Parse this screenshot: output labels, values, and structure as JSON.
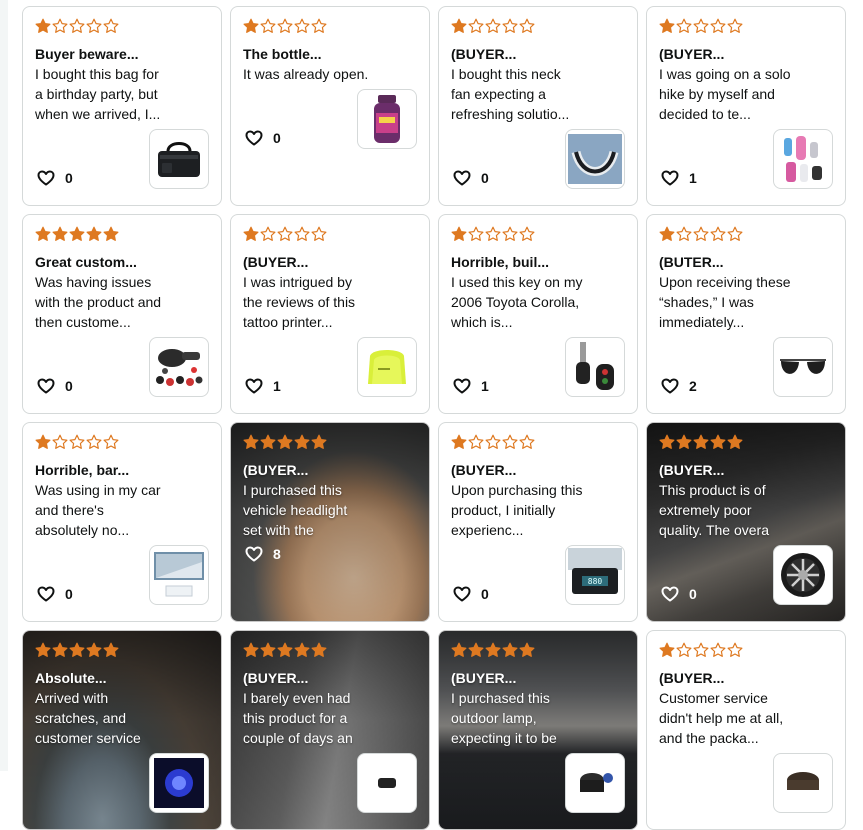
{
  "colors": {
    "star_fill": "#de7921",
    "star_empty_stroke": "#de7921",
    "card_border": "#d5d9d9",
    "text": "#0f1111"
  },
  "reviews": [
    {
      "rating": 1,
      "title": "Buyer beware...",
      "body": "I bought this bag for a birthday party, but when we arrived, I...",
      "likes": "0",
      "thumb_icon": "cooler-bag-icon"
    },
    {
      "rating": 1,
      "title": "The bottle...",
      "body": "It was already open.",
      "likes": "0",
      "thumb_icon": "supplement-bottle-icon"
    },
    {
      "rating": 1,
      "title": "(BUYER...",
      "body": "I bought this neck fan expecting a refreshing solutio...",
      "likes": "0",
      "thumb_icon": "neck-fan-icon"
    },
    {
      "rating": 1,
      "title": "(BUYER...",
      "body": "I was going on a solo hike by myself and decided to te...",
      "likes": "1",
      "thumb_icon": "water-bottles-icon"
    },
    {
      "rating": 5,
      "title": "Great custom...",
      "body": "Was having issues with the product and then custome...",
      "likes": "0",
      "thumb_icon": "polisher-kit-icon"
    },
    {
      "rating": 1,
      "title": "(BUYER...",
      "body": "I was intrigued by the reviews of this tattoo printer...",
      "likes": "1",
      "thumb_icon": "tattoo-printer-icon"
    },
    {
      "rating": 1,
      "title": "Horrible, buil...",
      "body": "I used this key on my 2006 Toyota Corolla, which is...",
      "likes": "1",
      "thumb_icon": "car-key-icon"
    },
    {
      "rating": 1,
      "title": "(BUTER...",
      "body": "Upon receiving these “shades,” I was immediately...",
      "likes": "2",
      "thumb_icon": "sunglasses-icon"
    },
    {
      "rating": 1,
      "title": "Horrible, bar...",
      "body": "Was using in my car and there's absolutely no...",
      "likes": "0",
      "thumb_icon": "windshield-shade-icon"
    },
    {
      "rating": 5,
      "title": "(BUYER...",
      "body": "I purchased this vehicle headlight set with the",
      "likes": "8",
      "photo": "arm-photo"
    },
    {
      "rating": 1,
      "title": "(BUYER...",
      "body": "Upon purchasing this product, I initially experienc...",
      "likes": "0",
      "thumb_icon": "car-display-icon"
    },
    {
      "rating": 5,
      "title": "(BUYER...",
      "body": "This product is of extremely poor quality. The overa",
      "likes": "0",
      "photo": "dashboard-photo",
      "thumb_icon": "wheel-cover-icon"
    },
    {
      "rating": 5,
      "title": "Absolute...",
      "body": "Arrived with scratches, and customer service",
      "photo": "solar-light-photo",
      "thumb_icon": "blue-light-icon"
    },
    {
      "rating": 5,
      "title": "(BUYER...",
      "body": "I barely even had this product for a couple of days an",
      "photo": "door-photo",
      "thumb_icon": "mount-icon"
    },
    {
      "rating": 5,
      "title": "(BUYER...",
      "body": "I purchased this outdoor lamp, expecting it to be",
      "photo": "car-interior-photo",
      "thumb_icon": "cup-holder-icon"
    },
    {
      "rating": 1,
      "title": "(BUYER...",
      "body": "Customer service didn't help me at all, and the packa...",
      "thumb_icon": "round-product-icon"
    }
  ]
}
